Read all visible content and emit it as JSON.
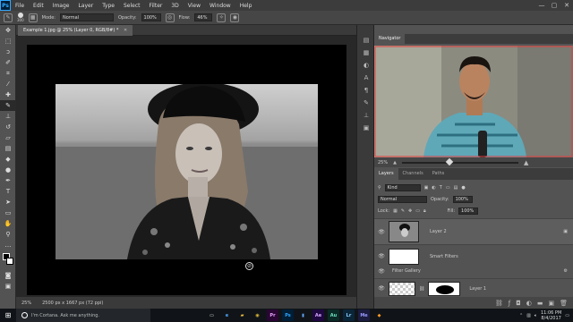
{
  "app": {
    "logo": "Ps"
  },
  "menubar": {
    "items": [
      "File",
      "Edit",
      "Image",
      "Layer",
      "Type",
      "Select",
      "Filter",
      "3D",
      "View",
      "Window",
      "Help"
    ],
    "window_buttons": [
      "—",
      "▢",
      "✕"
    ]
  },
  "options_bar": {
    "brush_size": "300",
    "mode_label": "Mode:",
    "mode_value": "Normal",
    "opacity_label": "Opacity:",
    "opacity_value": "100%",
    "flow_label": "Flow:",
    "flow_value": "46%"
  },
  "document": {
    "tab_label": "Example 1.jpg @ 25% (Layer 0, RGB/8#) *",
    "status_zoom": "25%",
    "status_doc": "2500 px x 1667 px (72 ppi)"
  },
  "navigator": {
    "tab": "Navigator",
    "zoom": "25%"
  },
  "layers_panel": {
    "tabs": [
      "Layers",
      "Channels",
      "Paths"
    ],
    "filter_label": "Kind",
    "blend_mode": "Normal",
    "opacity_label": "Opacity:",
    "opacity_value": "100%",
    "lock_label": "Lock:",
    "fill_label": "Fill:",
    "fill_value": "100%",
    "layers": [
      {
        "name": "Layer 2"
      },
      {
        "name": "Smart Filters"
      },
      {
        "name": "Filter Gallery"
      },
      {
        "name": "Layer 1"
      }
    ]
  },
  "taskbar": {
    "cortana_text": "I'm Cortana. Ask me anything.",
    "apps": [
      {
        "name": "task-view",
        "glyph": "▭",
        "color": "#ffffff",
        "bg": "#101418"
      },
      {
        "name": "edge",
        "glyph": "e",
        "color": "#4ea7ff",
        "bg": "#101418"
      },
      {
        "name": "file-explorer",
        "glyph": "▰",
        "color": "#f3c440",
        "bg": "#101418"
      },
      {
        "name": "chrome",
        "glyph": "◉",
        "color": "#e8c23a",
        "bg": "#101418"
      },
      {
        "name": "premiere",
        "glyph": "Pr",
        "color": "#e9a6ff",
        "bg": "#2a0634"
      },
      {
        "name": "photoshop",
        "glyph": "Ps",
        "color": "#31a8ff",
        "bg": "#001e36"
      },
      {
        "name": "prelude",
        "glyph": "▮",
        "color": "#66aaff",
        "bg": "#101418"
      },
      {
        "name": "after-effects",
        "glyph": "Ae",
        "color": "#d4a6ff",
        "bg": "#1f0740"
      },
      {
        "name": "audition",
        "glyph": "Au",
        "color": "#6fe3c1",
        "bg": "#0a2a26"
      },
      {
        "name": "lightroom",
        "glyph": "Lr",
        "color": "#8fd1ff",
        "bg": "#0a2538"
      },
      {
        "name": "media-encoder",
        "glyph": "Me",
        "color": "#9a9aff",
        "bg": "#1c1c40"
      },
      {
        "name": "app-orange",
        "glyph": "◆",
        "color": "#ff9b2a",
        "bg": "#101418"
      }
    ],
    "time": "11:06 PM",
    "date": "8/4/2017"
  }
}
